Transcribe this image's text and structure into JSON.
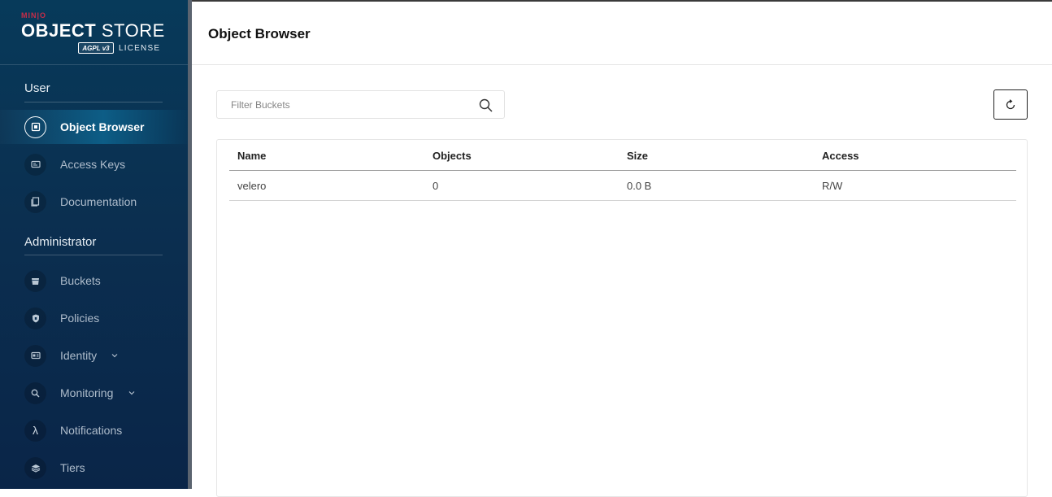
{
  "brand": {
    "vendor": "MIN|O",
    "product_bold": "OBJECT",
    "product_light": "STORE",
    "badge": "AGPL v3",
    "license": "LICENSE"
  },
  "sidebar": {
    "user_section": "User",
    "admin_section": "Administrator",
    "items": [
      {
        "label": "Object Browser",
        "icon": "object-browser-icon",
        "active": true
      },
      {
        "label": "Access Keys",
        "icon": "access-keys-icon"
      },
      {
        "label": "Documentation",
        "icon": "documentation-icon"
      },
      {
        "label": "Buckets",
        "icon": "buckets-icon"
      },
      {
        "label": "Policies",
        "icon": "policies-icon"
      },
      {
        "label": "Identity",
        "icon": "identity-icon",
        "expandable": true
      },
      {
        "label": "Monitoring",
        "icon": "monitoring-icon",
        "expandable": true
      },
      {
        "label": "Notifications",
        "icon": "lambda-icon"
      },
      {
        "label": "Tiers",
        "icon": "tiers-icon"
      }
    ]
  },
  "header": {
    "title": "Object Browser"
  },
  "search": {
    "placeholder": "Filter Buckets",
    "value": ""
  },
  "table": {
    "columns": [
      "Name",
      "Objects",
      "Size",
      "Access"
    ],
    "rows": [
      {
        "name": "velero",
        "objects": "0",
        "size": "0.0 B",
        "access": "R/W"
      }
    ]
  },
  "colors": {
    "sidebar_top": "#073a5a",
    "sidebar_bottom": "#0a2548",
    "brand_red": "#c72c48",
    "active_item": "#0d5d86"
  }
}
